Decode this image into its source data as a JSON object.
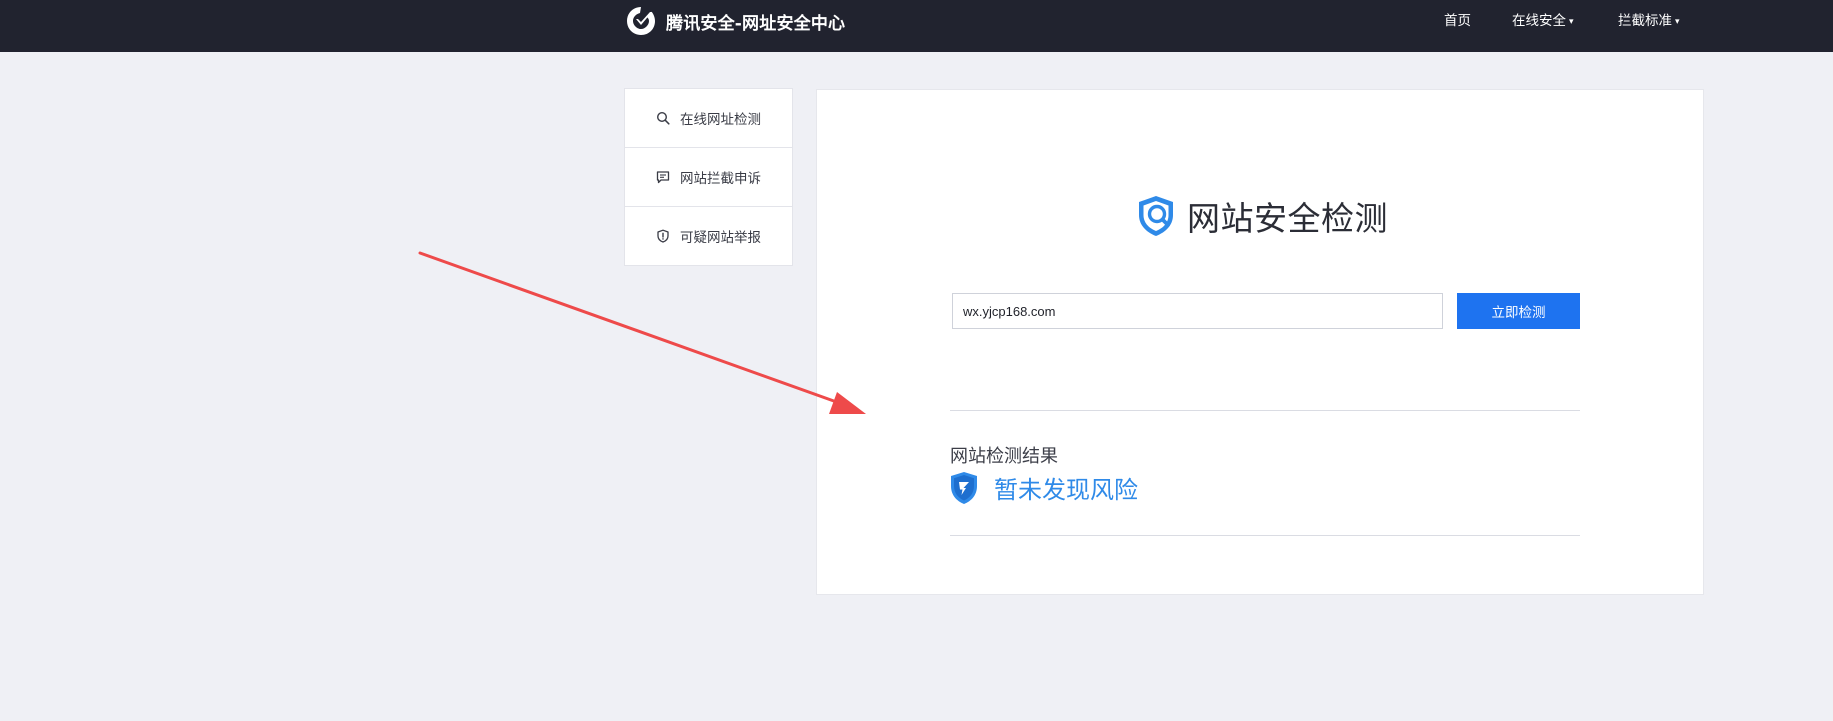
{
  "header": {
    "brand_title": "腾讯安全-网址安全中心",
    "logo_icon": "tencent-security-logo",
    "nav": [
      {
        "label": "首页",
        "has_dropdown": false
      },
      {
        "label": "在线安全",
        "has_dropdown": true
      },
      {
        "label": "拦截标准",
        "has_dropdown": true
      }
    ],
    "caret": "▾"
  },
  "sidebar": {
    "items": [
      {
        "label": "在线网址检测",
        "icon": "search-icon"
      },
      {
        "label": "网站拦截申诉",
        "icon": "message-icon"
      },
      {
        "label": "可疑网站举报",
        "icon": "shield-alert-icon"
      }
    ]
  },
  "main": {
    "title": "网站安全检测",
    "title_icon": "security-search-shield-icon",
    "url_input": {
      "value": "wx.yjcp168.com",
      "placeholder": ""
    },
    "check_button": "立即检测",
    "result": {
      "label": "网站检测结果",
      "status_text": "暂未发现风险",
      "status_icon": "safe-shield-icon"
    }
  },
  "colors": {
    "header_bg": "#21232f",
    "page_bg": "#eff0f5",
    "accent_blue": "#1e73f0",
    "result_blue": "#2f8ae8",
    "arrow_red": "#ee4a4a"
  }
}
